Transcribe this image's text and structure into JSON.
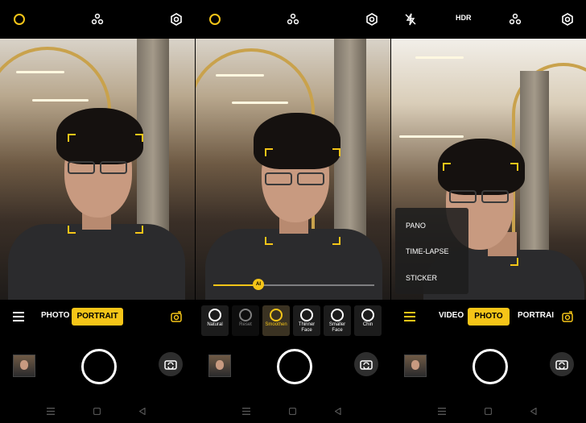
{
  "panels": [
    {
      "top_icons": [
        "flash-ring-icon",
        "ai-dots-icon",
        "settings-icon"
      ],
      "modes": {
        "left": "PHOTO",
        "active": "PORTRAIT"
      }
    },
    {
      "top_icons": [
        "flash-ring-icon",
        "ai-dots-icon",
        "settings-icon"
      ],
      "slider": {
        "knob_label": "AI",
        "level": 0.28
      },
      "beauty_options": [
        {
          "label": "Natural",
          "icon": "slash-circle-icon"
        },
        {
          "label": "Reset",
          "icon": "reset-icon"
        },
        {
          "label": "Smoothen",
          "icon": "smoothen-icon"
        },
        {
          "label": "Thinner Face",
          "icon": "face-outline-icon"
        },
        {
          "label": "Smaller Face",
          "icon": "face-dotted-icon"
        },
        {
          "label": "Chin",
          "icon": "chin-icon"
        }
      ],
      "selected_option": "Smoothen"
    },
    {
      "top_icons": [
        "flash-off-icon",
        "hdr-label",
        "ai-dots-icon",
        "settings-icon"
      ],
      "hdr_text": "HDR",
      "modes": {
        "left": "VIDEO",
        "active": "PHOTO",
        "right": "PORTRAI"
      },
      "more_menu": [
        "PANO",
        "TIME-LAPSE",
        "STICKER"
      ]
    }
  ],
  "colors": {
    "accent": "#f5c518",
    "background": "#000000"
  }
}
